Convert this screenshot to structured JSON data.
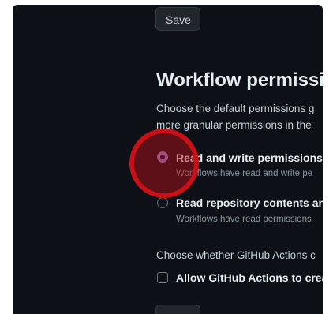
{
  "toolbar": {
    "save_label": "Save"
  },
  "workflow_permissions": {
    "title": "Workflow permissi",
    "description_line1": "Choose the default permissions g",
    "description_line2": "more granular permissions in the",
    "options": [
      {
        "label": "Read and write permissions",
        "description": "Workflows have read and write pe",
        "selected": true
      },
      {
        "label": "Read repository contents and",
        "description": "Workflows have read permissions",
        "selected": false
      }
    ],
    "actions_description": "Choose whether GitHub Actions c",
    "checkbox_label": "Allow GitHub Actions to crea",
    "checkbox_checked": false
  },
  "colors": {
    "background": "#0d1117",
    "radio_accent": "#8b7fd6",
    "click_marker": "#c81016"
  }
}
